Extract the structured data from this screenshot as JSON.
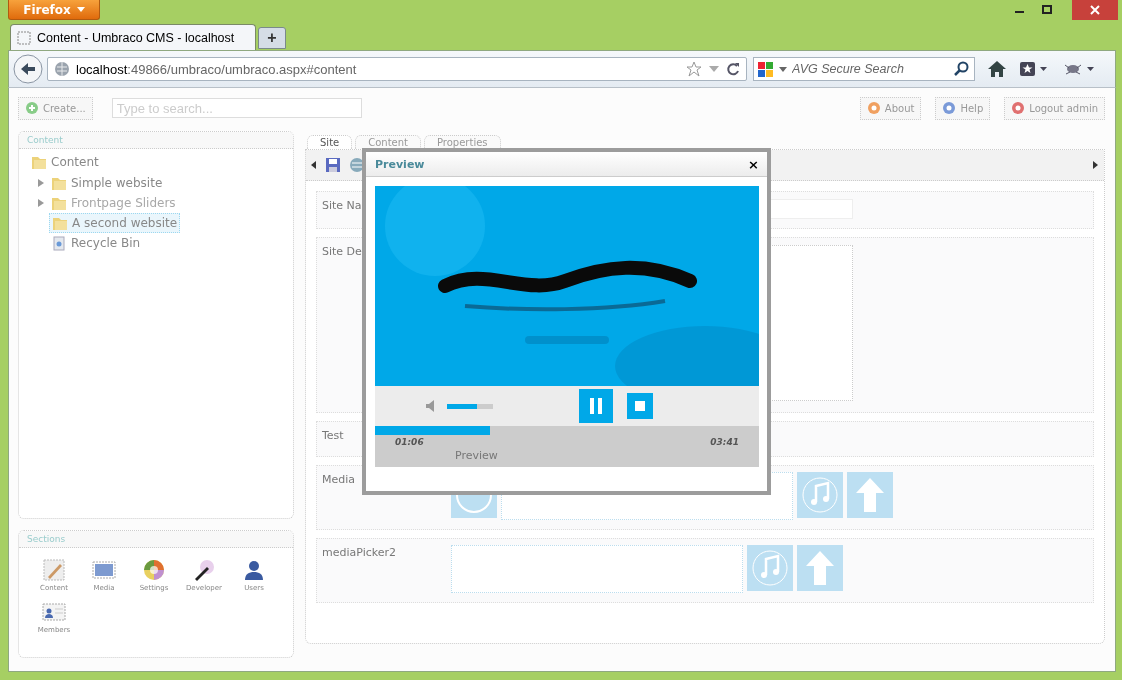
{
  "browser": {
    "menu_button": "Firefox",
    "tabs": [
      {
        "label": "Content - Umbraco CMS - localhost",
        "selected": true
      }
    ],
    "new_tab": "+",
    "url_host": "localhost",
    "url_rest": ":49866/umbraco/umbraco.aspx#content",
    "search_placeholder": "AVG Secure Search"
  },
  "toolbar": {
    "create": "Create...",
    "search_placeholder": "Type to search...",
    "buttons": [
      {
        "label": "About",
        "kind": "about"
      },
      {
        "label": "Help",
        "kind": "help"
      },
      {
        "label": "Logout admin",
        "kind": "logout"
      }
    ]
  },
  "tree": {
    "title": "Content",
    "root": {
      "label": "Content",
      "children": [
        {
          "label": "Simple website",
          "kind": "folder",
          "has_children": true,
          "disabled": false,
          "selected": false
        },
        {
          "label": "Frontpage Sliders",
          "kind": "folder",
          "has_children": true,
          "disabled": true,
          "selected": false
        },
        {
          "label": "A second website",
          "kind": "folder",
          "has_children": false,
          "disabled": false,
          "selected": true
        },
        {
          "label": "Recycle Bin",
          "kind": "bin",
          "has_children": false,
          "disabled": false,
          "selected": false
        }
      ]
    }
  },
  "sections": {
    "title": "Sections",
    "items": [
      {
        "label": "Content",
        "kind": "content"
      },
      {
        "label": "Media",
        "kind": "media"
      },
      {
        "label": "Settings",
        "kind": "settings"
      },
      {
        "label": "Developer",
        "kind": "developer"
      },
      {
        "label": "Users",
        "kind": "users"
      },
      {
        "label": "Members",
        "kind": "members"
      }
    ]
  },
  "editor": {
    "tabs": [
      {
        "label": "Site",
        "selected": true
      },
      {
        "label": "Content",
        "selected": false
      },
      {
        "label": "Properties",
        "selected": false
      }
    ],
    "fields": [
      {
        "label": "Site Na",
        "kind": "text"
      },
      {
        "label": "Site De",
        "kind": "textarea"
      },
      {
        "label": "Test",
        "kind": "plain"
      },
      {
        "label": "Media",
        "kind": "media_filled"
      },
      {
        "label": "mediaPicker2",
        "kind": "media"
      }
    ]
  },
  "modal": {
    "title": "Preview",
    "close": "×",
    "player": {
      "volume": {
        "level": 0.65
      },
      "playing": true,
      "progress": {
        "level": 0.3
      },
      "elapsed": "01:06",
      "total": "03:41",
      "caption": "Preview"
    }
  }
}
